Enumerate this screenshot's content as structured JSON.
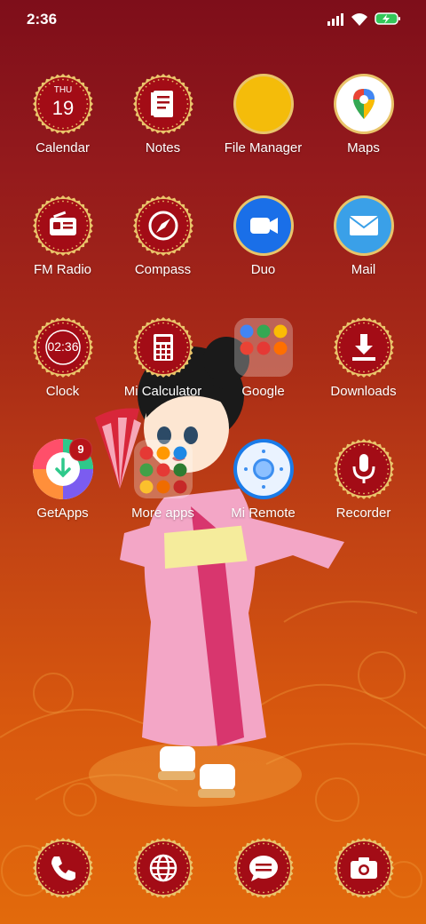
{
  "status_bar": {
    "time": "2:36",
    "icons": [
      "signal-icon",
      "wifi-icon",
      "battery-charging-icon"
    ]
  },
  "colors": {
    "background_top": "#7e0e1a",
    "background_bottom": "#e26a0c",
    "badge_red": "#a30c16",
    "badge_gold": "#e9c46a",
    "text": "#ffffff"
  },
  "calendar": {
    "weekday": "THU",
    "day": "19"
  },
  "clock": {
    "time": "02:36"
  },
  "apps": [
    {
      "label": "Calendar",
      "icon": "calendar-icon"
    },
    {
      "label": "Notes",
      "icon": "notes-icon"
    },
    {
      "label": "File Manager",
      "icon": "folder-icon"
    },
    {
      "label": "Maps",
      "icon": "maps-pin-icon"
    },
    {
      "label": "FM Radio",
      "icon": "radio-icon"
    },
    {
      "label": "Compass",
      "icon": "compass-icon"
    },
    {
      "label": "Duo",
      "icon": "video-camera-icon"
    },
    {
      "label": "Mail",
      "icon": "envelope-icon"
    },
    {
      "label": "Clock",
      "icon": "clock-icon"
    },
    {
      "label": "Mi Calculator",
      "icon": "calculator-icon"
    },
    {
      "label": "Google",
      "icon": "folder-google-icon"
    },
    {
      "label": "Downloads",
      "icon": "download-icon"
    },
    {
      "label": "GetApps",
      "icon": "getapps-icon",
      "badge": "9"
    },
    {
      "label": "More apps",
      "icon": "folder-more-apps-icon"
    },
    {
      "label": "Mi Remote",
      "icon": "remote-icon"
    },
    {
      "label": "Recorder",
      "icon": "microphone-icon"
    }
  ],
  "dock": [
    {
      "icon": "phone-icon"
    },
    {
      "icon": "globe-icon"
    },
    {
      "icon": "messages-icon"
    },
    {
      "icon": "camera-icon"
    }
  ]
}
